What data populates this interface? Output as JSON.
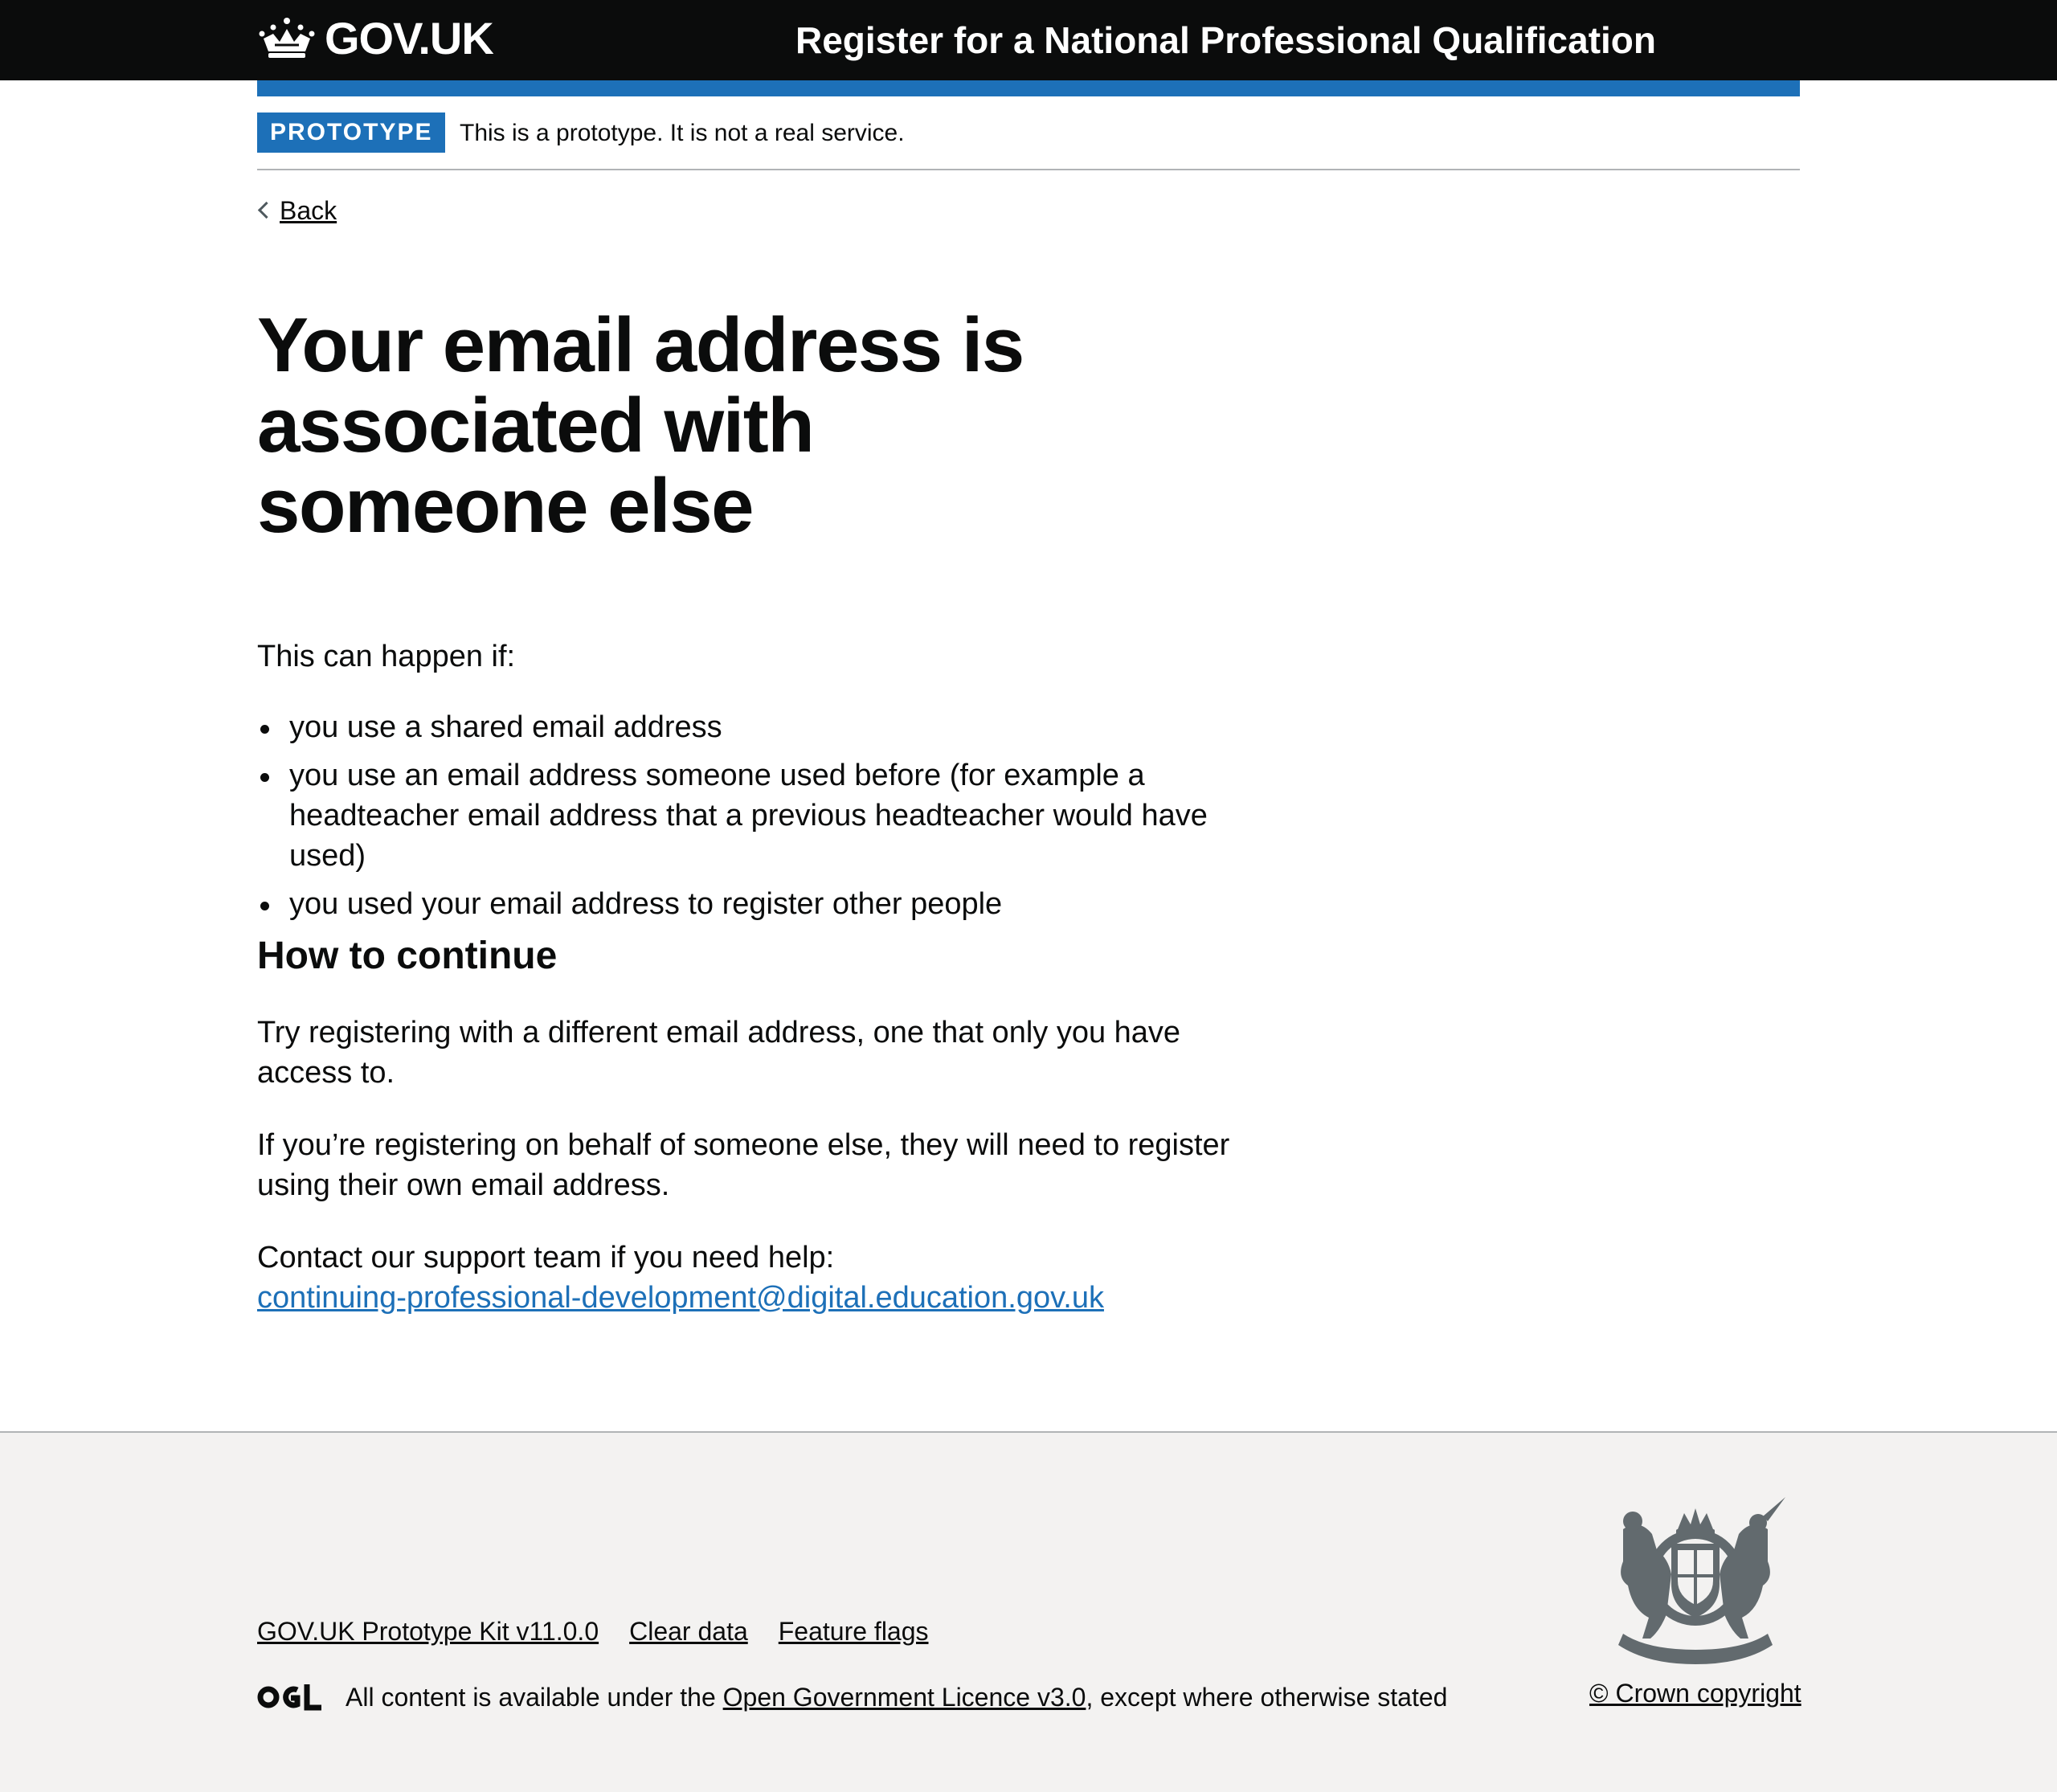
{
  "header": {
    "logotype": "GOV.UK",
    "service_name": "Register for a National Professional Qualification"
  },
  "phase_banner": {
    "tag": "PROTOTYPE",
    "text": "This is a prototype. It is not a real service."
  },
  "back_link": "Back",
  "main": {
    "title": "Your email address is associated with someone else",
    "intro": "This can happen if:",
    "reasons": [
      "you use a shared email address",
      "you use an email address someone used before (for example a headteacher email address that a previous headteacher would have used)",
      "you used your email address to register other people"
    ],
    "subheading": "How to continue",
    "para1": "Try registering with a different email address, one that only you have access to.",
    "para2": "If you’re registering on behalf of someone else, they will need to register using their own email address.",
    "para3_text": "Contact our support team if you need help:",
    "support_email": "continuing-professional-development@digital.education.gov.uk"
  },
  "footer": {
    "links": [
      "GOV.UK Prototype Kit v11.0.0",
      "Clear data",
      "Feature flags"
    ],
    "licence_prefix": "All content is available under the ",
    "licence_link": "Open Government Licence v3.0",
    "licence_suffix": ", except where otherwise stated",
    "crown_copyright": "© Crown copyright"
  },
  "colors": {
    "header_bg": "#0b0c0c",
    "brand_blue": "#1d70b8",
    "footer_bg": "#f3f2f1",
    "link": "#1d70b8"
  }
}
